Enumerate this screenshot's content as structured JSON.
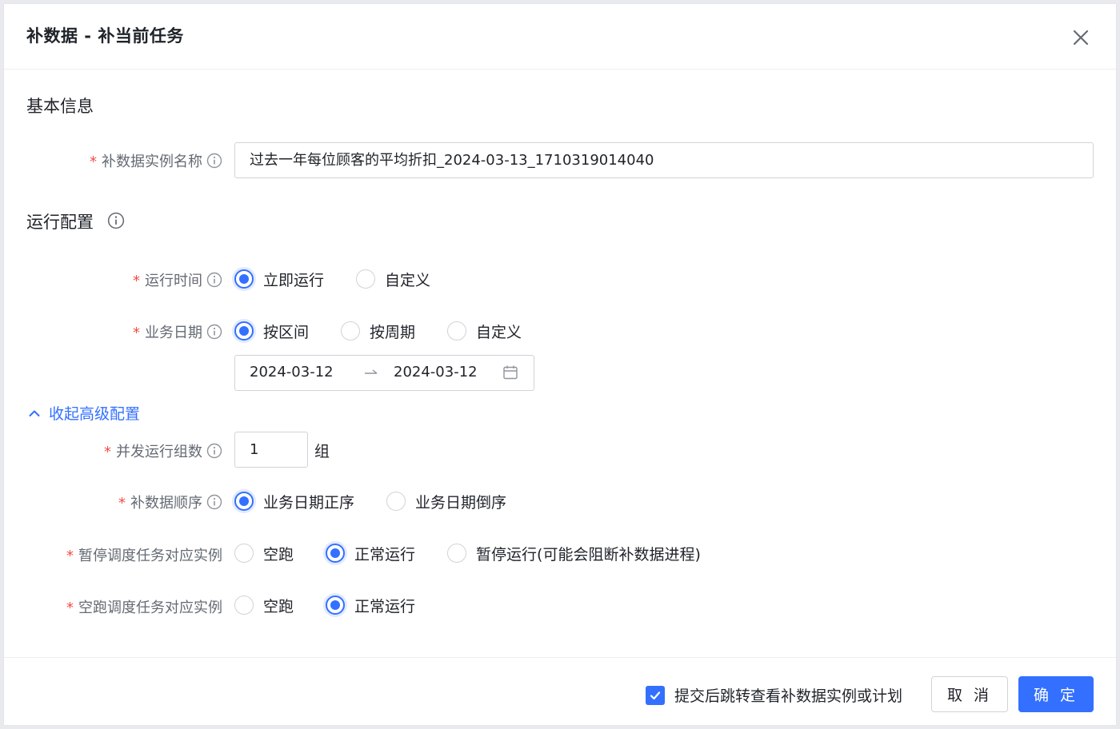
{
  "dialog": {
    "title": "补数据 - 补当前任务",
    "close_icon": "close-icon"
  },
  "basic": {
    "section_title": "基本信息",
    "name_label": "补数据实例名称",
    "name_value": "过去一年每位顾客的平均折扣_2024-03-13_1710319014040"
  },
  "run_config": {
    "section_title": "运行配置",
    "run_time": {
      "label": "运行时间",
      "options": [
        "立即运行",
        "自定义"
      ],
      "selected": "立即运行"
    },
    "biz_date": {
      "label": "业务日期",
      "options": [
        "按区间",
        "按周期",
        "自定义"
      ],
      "selected": "按区间",
      "range_start": "2024-03-12",
      "range_end": "2024-03-12",
      "separator": "→"
    }
  },
  "advanced": {
    "toggle_label": "收起高级配置",
    "parallel": {
      "label": "并发运行组数",
      "value": "1",
      "unit": "组"
    },
    "order": {
      "label": "补数据顺序",
      "options": [
        "业务日期正序",
        "业务日期倒序"
      ],
      "selected": "业务日期正序"
    },
    "paused": {
      "label": "暂停调度任务对应实例",
      "options": [
        "空跑",
        "正常运行",
        "暂停运行(可能会阻断补数据进程)"
      ],
      "selected": "正常运行"
    },
    "dry_run": {
      "label": "空跑调度任务对应实例",
      "options": [
        "空跑",
        "正常运行"
      ],
      "selected": "正常运行"
    }
  },
  "footer": {
    "checkbox_label": "提交后跳转查看补数据实例或计划",
    "checkbox_checked": true,
    "cancel_label": "取 消",
    "ok_label": "确 定"
  },
  "colors": {
    "primary": "#3370ff",
    "required": "#f54a45",
    "label": "#646a73"
  }
}
